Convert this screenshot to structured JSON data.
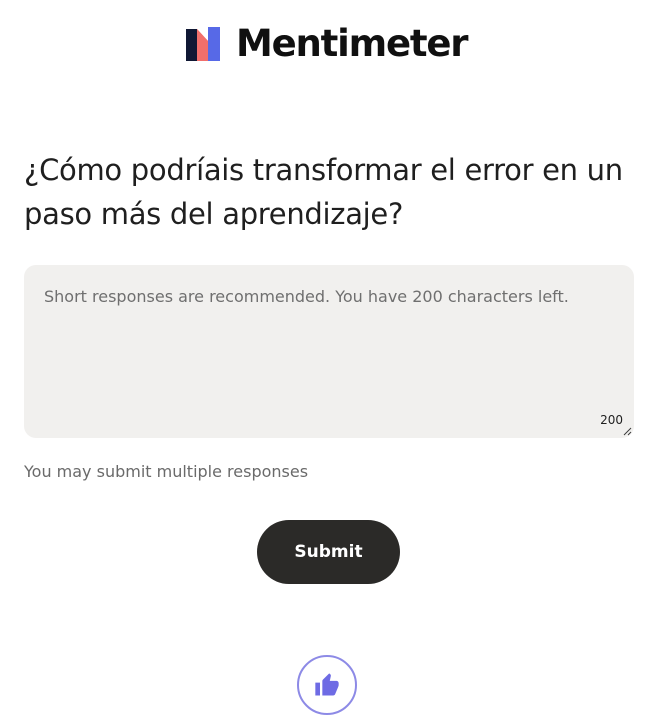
{
  "brand": {
    "name": "Mentimeter",
    "mark_colors": {
      "dark": "#101834",
      "accent": "#5769e7",
      "coral": "#f16f6c"
    }
  },
  "question": {
    "title": "¿Cómo podríais transformar el error en un paso más del aprendizaje?"
  },
  "response": {
    "placeholder": "Short responses are recommended. You have 200 characters left.",
    "value": "",
    "char_count": "200"
  },
  "hint": "You may submit multiple responses",
  "submit_label": "Submit",
  "reaction": {
    "icon": "thumbs-up-icon",
    "color": "#6e6be4"
  }
}
